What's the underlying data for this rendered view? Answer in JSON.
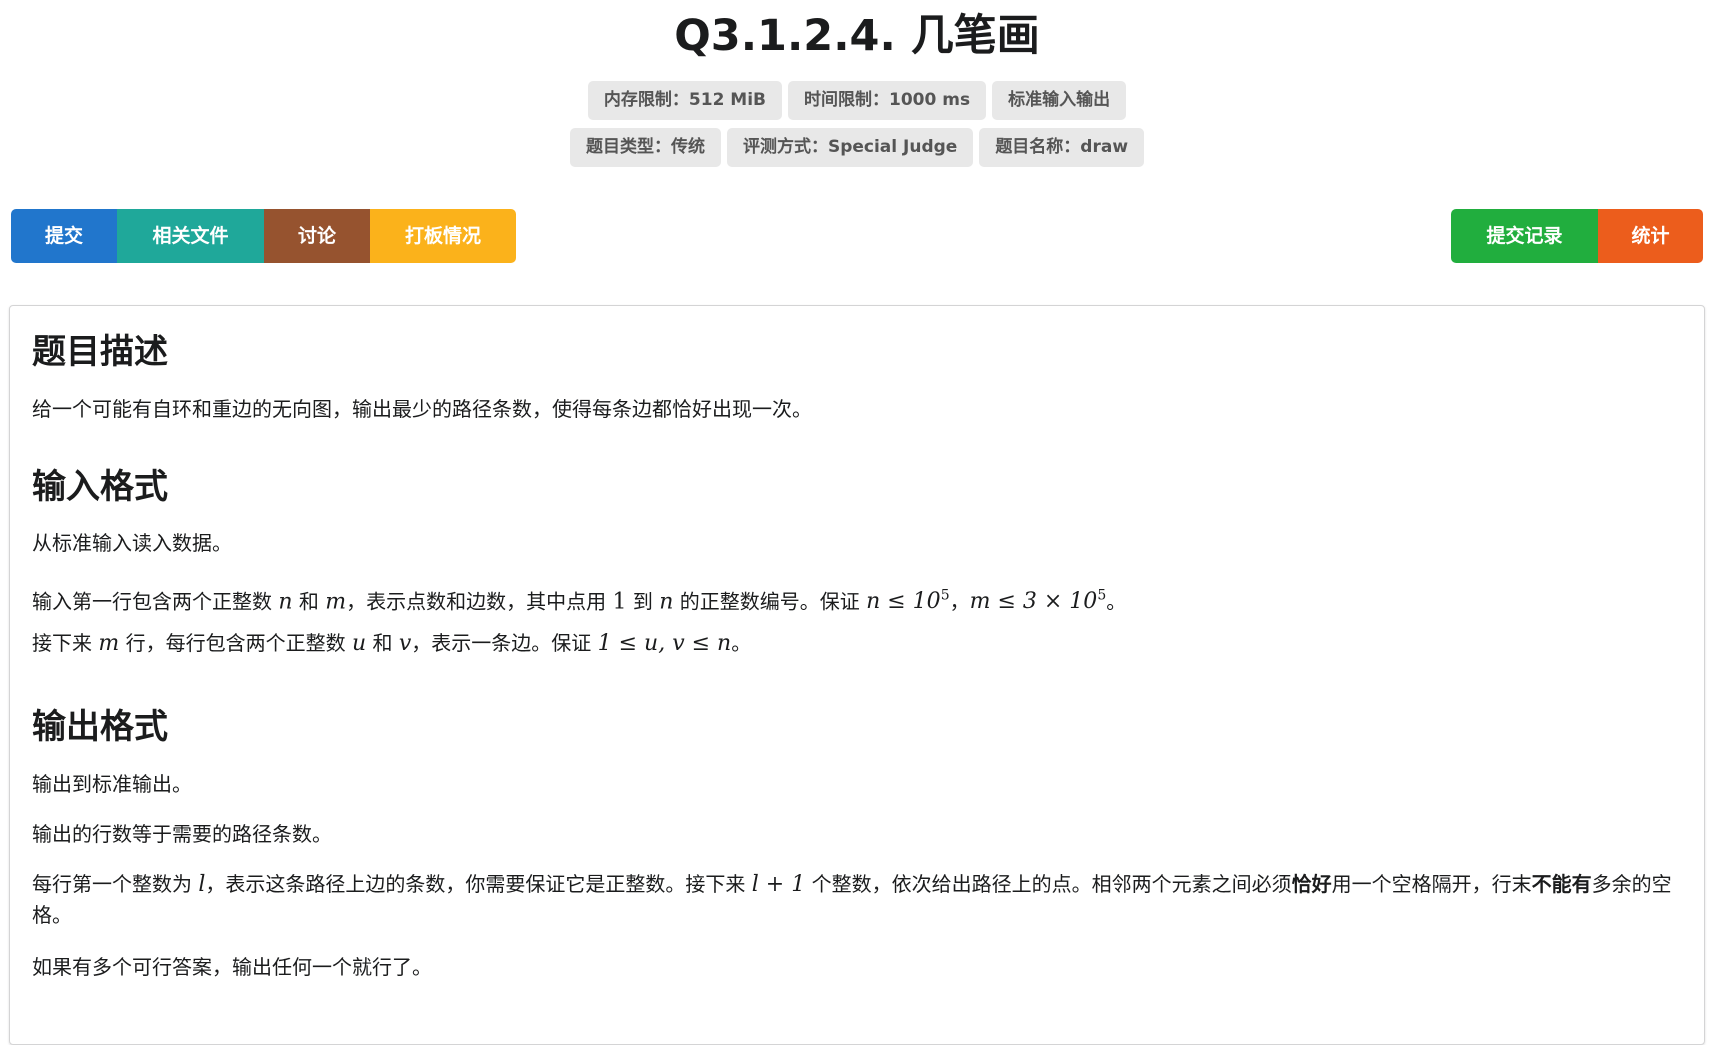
{
  "problem": {
    "title": "Q3.1.2.4. 几笔画"
  },
  "tags": {
    "row1": [
      "内存限制：512 MiB",
      "时间限制：1000 ms",
      "标准输入输出"
    ],
    "row2": [
      "题目类型：传统",
      "评测方式：Special Judge",
      "题目名称：draw"
    ]
  },
  "buttons": {
    "submit": "提交",
    "files": "相关文件",
    "discuss": "讨论",
    "board": "打板情况",
    "records": "提交记录",
    "stats": "统计"
  },
  "colors": {
    "submit": "#2176cc",
    "files": "#1fa89a",
    "discuss": "#96532f",
    "board": "#fbb21b",
    "records": "#21ae3e",
    "stats": "#ec5d1c"
  },
  "sections": {
    "description": {
      "heading": "题目描述",
      "text": "给一个可能有自环和重边的无向图，输出最少的路径条数，使得每条边都恰好出现一次。"
    },
    "input": {
      "heading": "输入格式",
      "p1": "从标准输入读入数据。",
      "p2": {
        "a": "输入第一行包含两个正整数 ",
        "n": "n",
        "b": " 和 ",
        "m": "m",
        "c": "，表示点数和边数，其中点用 ",
        "one": "1",
        "d": " 到 ",
        "n2": "n",
        "e": " 的正整数编号。保证 ",
        "cond1": "n ≤ 10",
        "exp1": "5",
        "f": "，",
        "cond2": "m ≤ 3 × 10",
        "exp2": "5",
        "g": "。"
      },
      "p3": {
        "a": "接下来 ",
        "m": "m",
        "b": " 行，每行包含两个正整数 ",
        "u": "u",
        "c": " 和 ",
        "v": "v",
        "d": "，表示一条边。保证 ",
        "cond": "1 ≤ u, v ≤ n",
        "e": "。"
      }
    },
    "output": {
      "heading": "输出格式",
      "p1": "输出到标准输出。",
      "p2": "输出的行数等于需要的路径条数。",
      "p3": {
        "a": "每行第一个整数为 ",
        "l": "l",
        "b": "，表示这条路径上边的条数，你需要保证它是正整数。接下来 ",
        "expr": "l + 1",
        "c": " 个整数，依次给出路径上的点。相邻两个元素之间必须",
        "bold1": "恰好",
        "d": "用一个空格隔开，行末",
        "bold2": "不能有",
        "e": "多余的空格。"
      },
      "p4": "如果有多个可行答案，输出任何一个就行了。"
    }
  }
}
